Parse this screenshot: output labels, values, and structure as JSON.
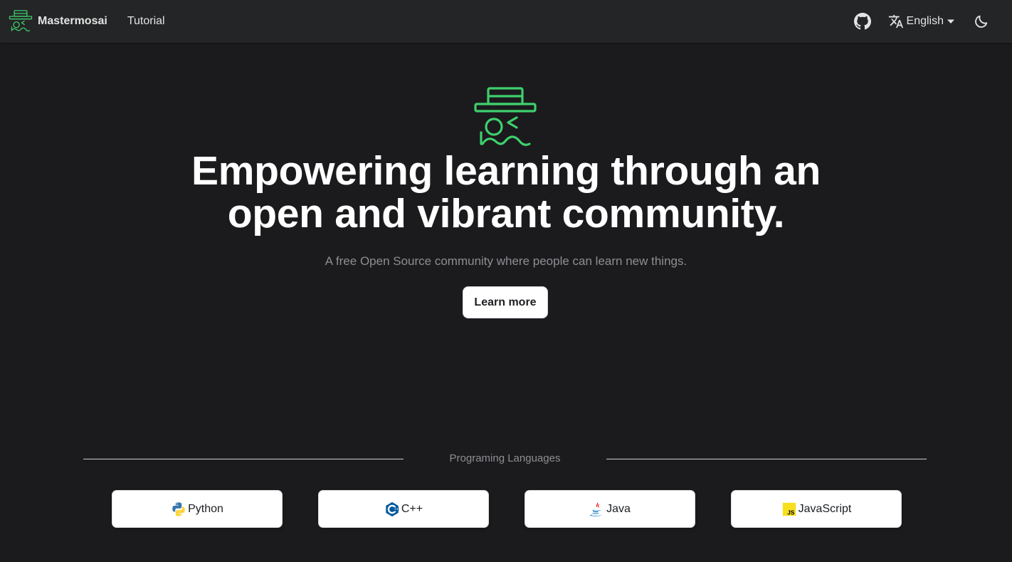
{
  "navbar": {
    "brand": "Mastermosai",
    "links": [
      {
        "label": "Tutorial"
      }
    ],
    "language": "English"
  },
  "hero": {
    "title_line1": "Empowering learning through an",
    "title_line2": "open and vibrant community.",
    "subtitle": "A free Open Source community where people can learn new things.",
    "cta": "Learn more"
  },
  "languages_section": {
    "heading": "Programing Languages",
    "items": [
      {
        "label": "Python",
        "icon": "python-icon"
      },
      {
        "label": "C++",
        "icon": "cpp-icon"
      },
      {
        "label": "Java",
        "icon": "java-icon"
      },
      {
        "label": "JavaScript",
        "icon": "javascript-icon"
      }
    ]
  },
  "colors": {
    "background": "#1b1b1d",
    "navbar": "#242526",
    "brand_green": "#3ecf6e"
  }
}
